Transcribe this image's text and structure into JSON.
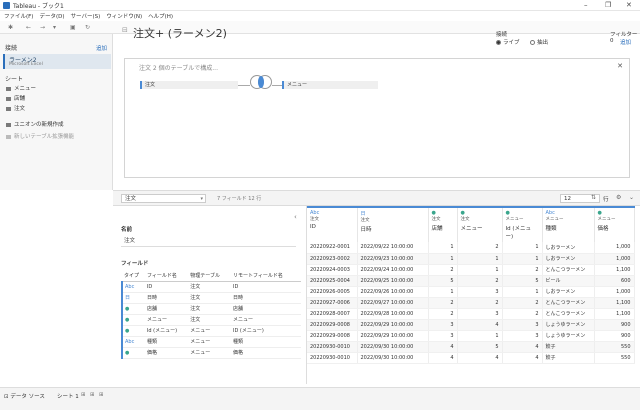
{
  "window": {
    "title": "Tableau - ブック1"
  },
  "menu": [
    "ファイル(F)",
    "データ(D)",
    "サーバー(S)",
    "ウィンドウ(N)",
    "ヘルプ(H)"
  ],
  "left": {
    "connections_label": "接続",
    "add_label": "追加",
    "connection_name": "ラーメン2",
    "connection_type": "Microsoft Excel",
    "sheets_label": "シート",
    "sheets": [
      "メニュー",
      "店舗",
      "注文"
    ],
    "union_label": "ユニオンの新規作成",
    "new_table_label": "新しいテーブル拡張機能"
  },
  "canvas": {
    "title": "注文+ (ラーメン2)",
    "connection_label": "接続",
    "live_label": "ライブ",
    "extract_label": "抽出",
    "filter_label": "フィルター",
    "filter_count": "0",
    "filter_add": "追加",
    "join_title": "注文 2 個のテーブルで構成...",
    "left_table": "注文",
    "right_table": "メニュー"
  },
  "gridbar": {
    "table_select": "注文",
    "field_info": "7 フィールド 12 行",
    "rows_value": "12",
    "rows_label": "行"
  },
  "meta": {
    "name_label": "名前",
    "name_value": "注文",
    "fields_label": "フィールド",
    "headers": [
      "タイプ",
      "フィールド名",
      "物理テーブル",
      "リモートフィールド名"
    ],
    "rows": [
      [
        "Abc",
        "ID",
        "注文",
        "ID"
      ],
      [
        "日",
        "日時",
        "注文",
        "日時"
      ],
      [
        "●",
        "店舗",
        "注文",
        "店舗"
      ],
      [
        "●",
        "メニュー",
        "注文",
        "メニュー"
      ],
      [
        "●",
        "Id (メニュー)",
        "メニュー",
        "ID (メニュー)"
      ],
      [
        "Abc",
        "種類",
        "メニュー",
        "種類"
      ],
      [
        "●",
        "価格",
        "メニュー",
        "価格"
      ]
    ]
  },
  "grid": {
    "columns": [
      {
        "type": "Abc",
        "table": "注文",
        "name": "ID"
      },
      {
        "type": "日",
        "table": "注文",
        "name": "日時"
      },
      {
        "type": "●",
        "table": "注文",
        "name": "店舗"
      },
      {
        "type": "●",
        "table": "注文",
        "name": "メニュー"
      },
      {
        "type": "●",
        "table": "メニュー",
        "name": "Id (メニュー)"
      },
      {
        "type": "Abc",
        "table": "メニュー",
        "name": "種類"
      },
      {
        "type": "●",
        "table": "メニュー",
        "name": "価格"
      }
    ],
    "rows": [
      [
        "20220922-0001",
        "2022/09/22 10:00:00",
        "1",
        "2",
        "1",
        "しおラーメン",
        "1,000"
      ],
      [
        "20220923-0002",
        "2022/09/23 10:00:00",
        "1",
        "1",
        "1",
        "しおラーメン",
        "1,000"
      ],
      [
        "20220924-0003",
        "2022/09/24 10:00:00",
        "2",
        "1",
        "2",
        "とんこつラーメン",
        "1,100"
      ],
      [
        "20220925-0004",
        "2022/09/25 10:00:00",
        "5",
        "2",
        "5",
        "ビール",
        "600"
      ],
      [
        "20220926-0005",
        "2022/09/26 10:00:00",
        "1",
        "3",
        "1",
        "しおラーメン",
        "1,000"
      ],
      [
        "20220927-0006",
        "2022/09/27 10:00:00",
        "2",
        "2",
        "2",
        "とんこつラーメン",
        "1,100"
      ],
      [
        "20220928-0007",
        "2022/09/28 10:00:00",
        "2",
        "3",
        "2",
        "とんこつラーメン",
        "1,100"
      ],
      [
        "20220929-0008",
        "2022/09/29 10:00:00",
        "3",
        "4",
        "3",
        "しょうゆラーメン",
        "900"
      ],
      [
        "20220929-0008",
        "2022/09/29 10:00:00",
        "3",
        "1",
        "3",
        "しょうゆラーメン",
        "900"
      ],
      [
        "20220930-0010",
        "2022/09/30 10:00:00",
        "4",
        "5",
        "4",
        "餃子",
        "550"
      ],
      [
        "20220930-0010",
        "2022/09/30 10:00:00",
        "4",
        "4",
        "4",
        "餃子",
        "550"
      ]
    ]
  },
  "status": {
    "datasource_tab": "データ ソース",
    "sheet_tab": "シート 1"
  }
}
